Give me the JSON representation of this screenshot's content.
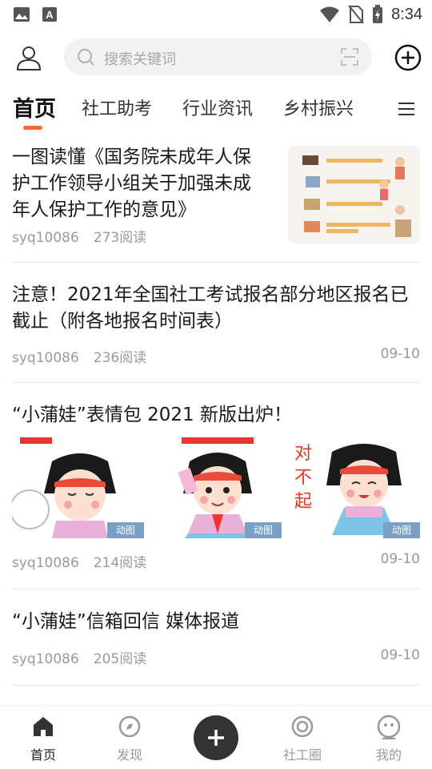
{
  "status_bar": {
    "time": "8:34"
  },
  "search": {
    "placeholder": "搜索关键词"
  },
  "tabs": [
    {
      "label": "首页",
      "active": true
    },
    {
      "label": "社工助考"
    },
    {
      "label": "行业资讯"
    },
    {
      "label": "乡村振兴"
    }
  ],
  "articles": [
    {
      "title": "一图读懂《国务院未成年人保护工作领导小组关于加强未成年人保护工作的意见》",
      "author": "syq10086",
      "reads": "273阅读",
      "date": ""
    },
    {
      "title": "注意！2021年全国社工考试报名部分地区报名已截止（附各地报名时间表）",
      "author": "syq10086",
      "reads": "236阅读",
      "date": "09-10"
    },
    {
      "title": "“小蒲娃”表情包 2021 新版出炉！",
      "author": "syq10086",
      "reads": "214阅读",
      "date": "09-10",
      "image_badges": [
        "动图",
        "动图",
        "动图"
      ],
      "sticker_texts": [
        "对",
        "不",
        "起"
      ]
    },
    {
      "title": "“小蒲娃”信箱回信 媒体报道",
      "author": "syq10086",
      "reads": "205阅读",
      "date": "09-10"
    }
  ],
  "bottom_nav": [
    {
      "label": "首页",
      "icon": "home-icon",
      "active": true
    },
    {
      "label": "发现",
      "icon": "discover-icon"
    },
    {
      "label": "",
      "icon": "plus-icon"
    },
    {
      "label": "社工圈",
      "icon": "circle-icon"
    },
    {
      "label": "我的",
      "icon": "profile-icon"
    }
  ],
  "colors": {
    "accent": "#ff6a2a",
    "text": "#1a1a1a",
    "muted": "#9a9a9a",
    "badge": "#7aa0c8"
  }
}
